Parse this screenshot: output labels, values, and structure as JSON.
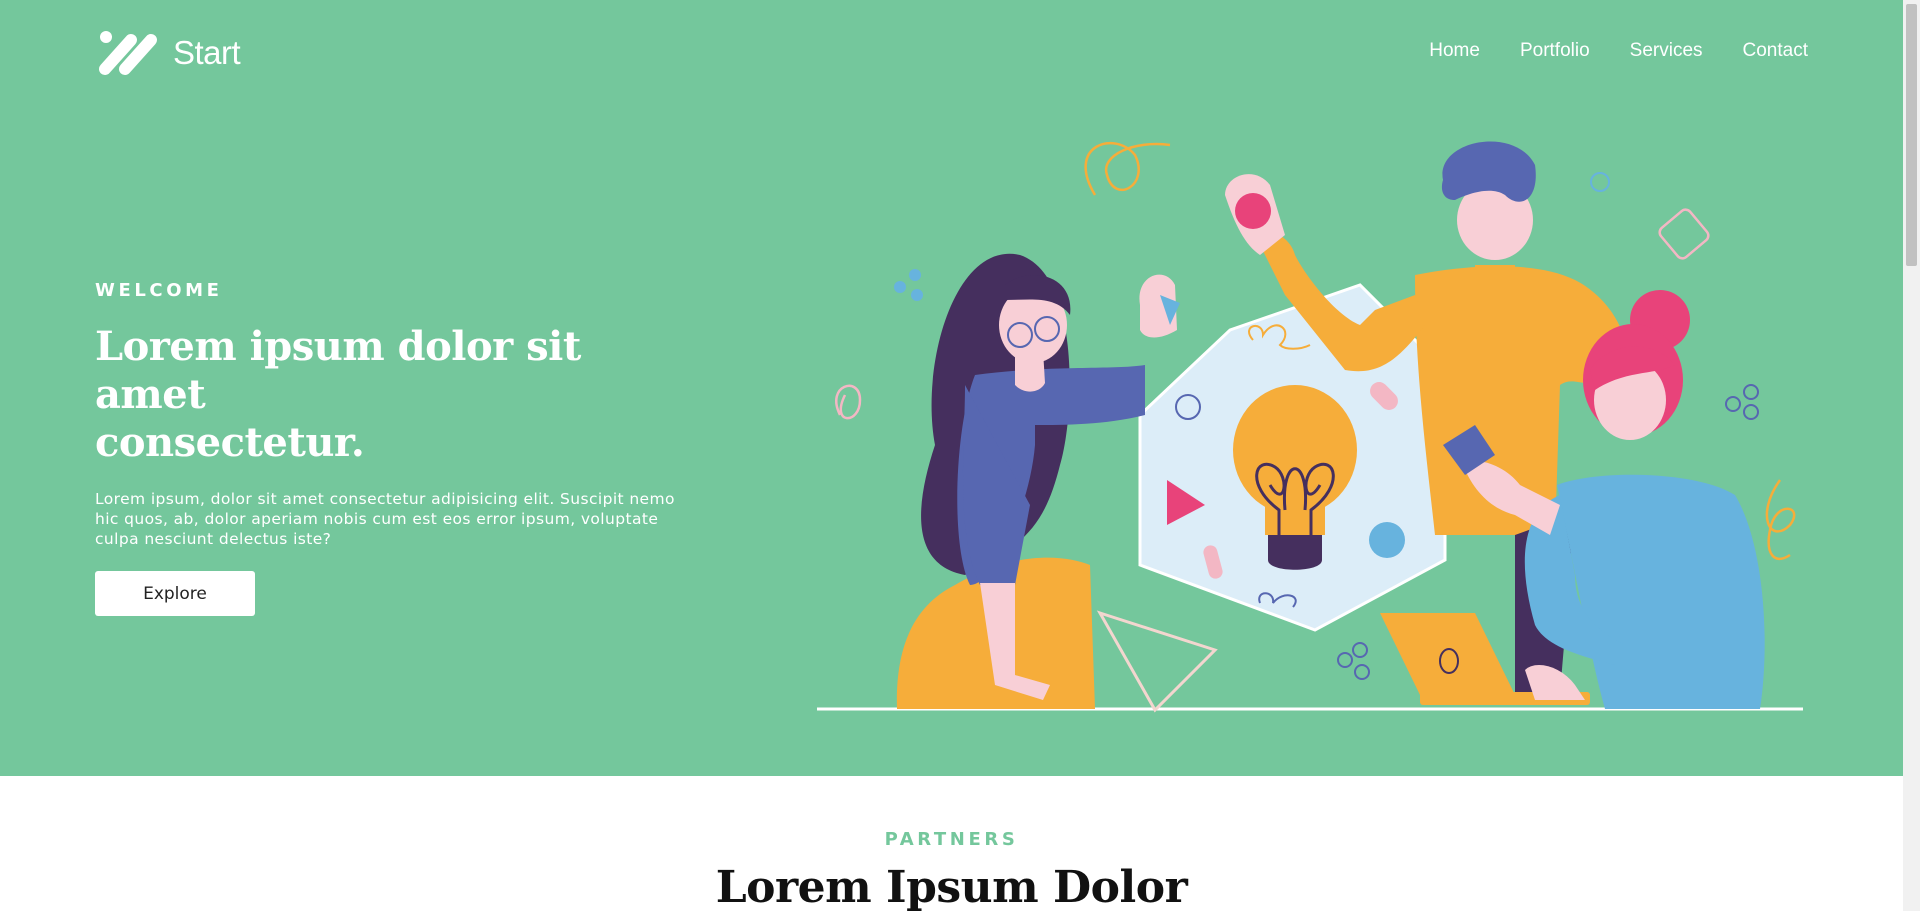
{
  "brand": {
    "name": "Start"
  },
  "nav": {
    "items": [
      "Home",
      "Portfolio",
      "Services",
      "Contact"
    ]
  },
  "hero": {
    "eyebrow": "WELCOME",
    "headline_line1": "Lorem ipsum dolor sit amet",
    "headline_line2": "consectetur.",
    "lede": "Lorem ipsum, dolor sit amet consectetur adipisicing elit. Suscipit nemo hic quos, ab, dolor aperiam nobis cum est eos error ipsum, voluptate culpa nesciunt delectus iste?",
    "cta": "Explore"
  },
  "partners": {
    "eyebrow": "PARTNERS",
    "title": "Lorem Ipsum Dolor"
  },
  "colors": {
    "accent": "#74c79c",
    "navy": "#5767b1",
    "yellow": "#f6ad3a",
    "pink": "#e8437a",
    "blue": "#67b3de",
    "purple": "#452f5e"
  }
}
